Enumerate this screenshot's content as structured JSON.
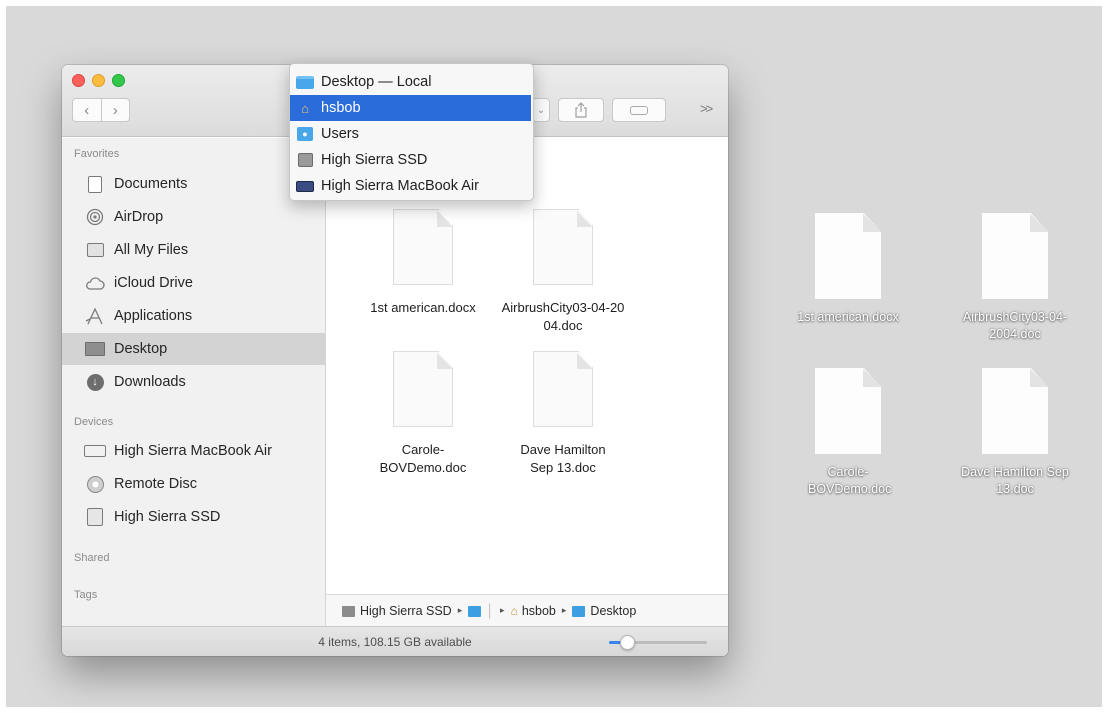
{
  "sidebar": {
    "favorites_heading": "Favorites",
    "favorites": [
      {
        "label": "Documents"
      },
      {
        "label": "AirDrop"
      },
      {
        "label": "All My Files"
      },
      {
        "label": "iCloud Drive"
      },
      {
        "label": "Applications"
      },
      {
        "label": "Desktop",
        "selected": true
      },
      {
        "label": "Downloads"
      }
    ],
    "devices_heading": "Devices",
    "devices": [
      {
        "label": "High Sierra MacBook Air"
      },
      {
        "label": "Remote Disc"
      },
      {
        "label": "High Sierra SSD"
      }
    ],
    "shared_heading": "Shared",
    "tags_heading": "Tags"
  },
  "toolbar": {
    "back_icon": "chevron-left-icon",
    "forward_icon": "chevron-right-icon",
    "arrange_icon": "chevron-down-icon",
    "share_icon": "share-icon",
    "tag_icon": "tag-icon",
    "overflow_label": ">>"
  },
  "path_menu": {
    "items": [
      {
        "label": "Desktop — Local",
        "icon": "folder-icon"
      },
      {
        "label": "hsbob",
        "icon": "home-icon",
        "highlighted": true
      },
      {
        "label": "Users",
        "icon": "users-folder-icon"
      },
      {
        "label": "High Sierra SSD",
        "icon": "drive-icon"
      },
      {
        "label": "High Sierra MacBook Air",
        "icon": "laptop-icon"
      }
    ]
  },
  "files": [
    {
      "name": "1st american.docx"
    },
    {
      "name": "AirbrushCity03-04-2004.doc"
    },
    {
      "name": "Carole-BOVDemo.doc"
    },
    {
      "name": "Dave Hamilton Sep 13.doc"
    }
  ],
  "path_bar": {
    "segments": [
      "High Sierra SSD",
      "",
      "hsbob",
      "Desktop"
    ]
  },
  "status": {
    "text": "4 items, 108.15 GB available",
    "icon_size_slider": 0.18
  },
  "desktop_icons": [
    {
      "name": "1st american.docx"
    },
    {
      "name": "AirbrushCity03-04-2004.doc"
    },
    {
      "name": "Carole-BOVDemo.doc"
    },
    {
      "name": "Dave Hamilton Sep 13.doc"
    }
  ],
  "colors": {
    "selection": "#2a6cd9",
    "folder": "#48a7e8",
    "slider_fill": "#3a86f0"
  }
}
